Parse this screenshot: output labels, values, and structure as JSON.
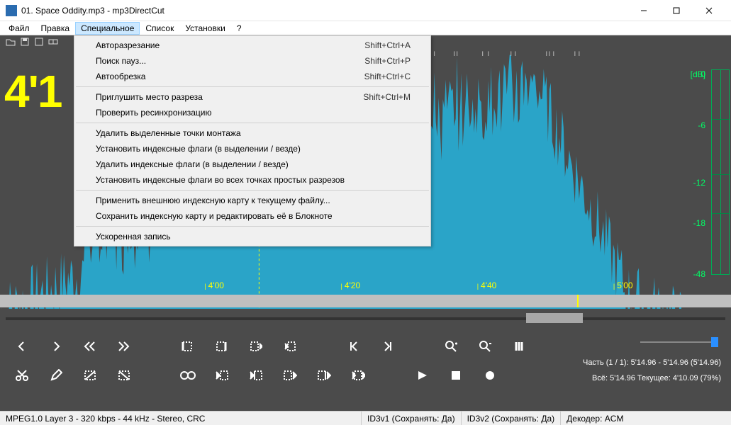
{
  "window": {
    "title": "01. Space Oddity.mp3 - mp3DirectCut"
  },
  "menubar": {
    "items": [
      "Файл",
      "Правка",
      "Специальное",
      "Список",
      "Установки",
      "?"
    ],
    "active_index": 2
  },
  "dropdown": {
    "groups": [
      [
        {
          "label": "Авторазрезание",
          "shortcut": "Shift+Ctrl+A"
        },
        {
          "label": "Поиск пауз...",
          "shortcut": "Shift+Ctrl+P"
        },
        {
          "label": "Автообрезка",
          "shortcut": "Shift+Ctrl+C"
        }
      ],
      [
        {
          "label": "Приглушить место разреза",
          "shortcut": "Shift+Ctrl+M"
        },
        {
          "label": "Проверить ресинхронизацию",
          "shortcut": ""
        }
      ],
      [
        {
          "label": "Удалить выделенные точки монтажа",
          "shortcut": ""
        },
        {
          "label": "Установить индексные флаги (в выделении / везде)",
          "shortcut": ""
        },
        {
          "label": "Удалить индексные флаги (в выделении / везде)",
          "shortcut": ""
        },
        {
          "label": "Установить индексные флаги во всех точках простых разрезов",
          "shortcut": ""
        }
      ],
      [
        {
          "label": "Применить внешнюю индексную карту к текущему файлу...",
          "shortcut": ""
        },
        {
          "label": "Сохранить индексную карту и редактировать её в Блокноте",
          "shortcut": ""
        }
      ],
      [
        {
          "label": "Ускоренная запись",
          "shortcut": ""
        }
      ]
    ]
  },
  "bigtime": "4'1",
  "db": {
    "header": "[dB]",
    "ticks": [
      {
        "label": "0",
        "pct": 0
      },
      {
        "label": "-6",
        "pct": 24
      },
      {
        "label": "-12",
        "pct": 51
      },
      {
        "label": "-18",
        "pct": 70
      },
      {
        "label": "-48",
        "pct": 94
      }
    ]
  },
  "ruler": {
    "ticks": [
      {
        "label": "4'00",
        "pct": 30
      },
      {
        "label": "4'20",
        "pct": 50
      },
      {
        "label": "4'40",
        "pct": 70
      },
      {
        "label": "5'00",
        "pct": 90
      }
    ]
  },
  "posbar": {
    "cursor_pct": 79
  },
  "mini_slider": {
    "thumb_pct": 72
  },
  "info": {
    "line1": "Часть (1 / 1): 5'14.96 - 5'14.96 (5'14.96)",
    "line2": "Всё: 5'14.96   Текущее: 4'10.09   (79%)"
  },
  "status": {
    "cell1": "MPEG1.0 Layer 3 - 320 kbps - 44 kHz - Stereo, CRC",
    "cell2": "ID3v1 (Сохранять: Да)",
    "cell3": "ID3v2 (Сохранять: Да)",
    "cell4": "Декодер: ACM"
  },
  "icons": {
    "toolbar_top": [
      "open",
      "save",
      "save-sel",
      "batch"
    ],
    "ruler_top_groups": 8
  }
}
